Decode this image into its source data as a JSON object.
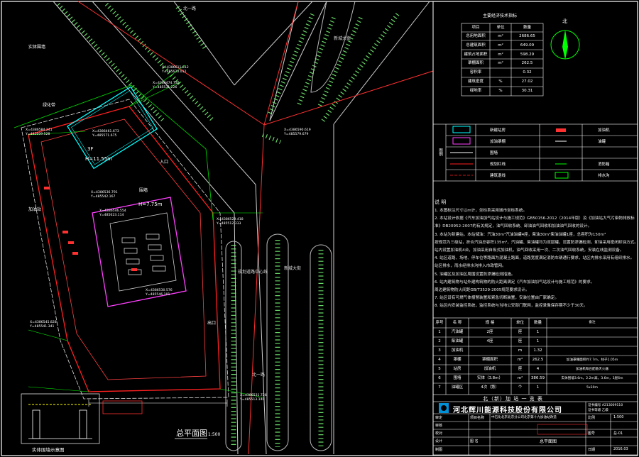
{
  "drawing": {
    "plan_title": "总平面图",
    "plan_scale": "1:500",
    "section_caption": "实体围墙示意图",
    "north_label": "北",
    "compass_header": "主要经济技术指标"
  },
  "site_labels": {
    "roads": [
      "北一路",
      "新城大街",
      "新城大街",
      "北一路"
    ],
    "building_3f": "3F",
    "building_height": "H=11.55m",
    "canopy_height": "H=7.75m",
    "entry": "入口",
    "exit": "出口",
    "weighbridge": "围墙",
    "greenbelt": "绿化带",
    "fence": "实体围墙",
    "station_name": "加油站",
    "planning_line": "规划道路中心线"
  },
  "coordinates": [
    "X=4386611.812",
    "Y=485620.012",
    "X=4386474.735",
    "Y=485531.226",
    "X=4386584.241",
    "Y=485609.528",
    "X=4386461.673",
    "Y=485571.675",
    "X=4386590.619",
    "Y=485579.679",
    "X=4386545.828",
    "Y=485541.341",
    "X=4386536.791",
    "Y=485542.167",
    "X=4386546.554",
    "Y=485623.114",
    "X=4386529.418",
    "Y=485512.333",
    "X=4386530.576",
    "Y=485546.101",
    "X=4386531.726",
    "Y=485513.140"
  ],
  "indicator_table": {
    "headers": [
      "项目",
      "单位",
      "数量"
    ],
    "rows": [
      [
        "总用地面积",
        "m²",
        "2686.65"
      ],
      [
        "总建筑面积",
        "m²",
        "649.09"
      ],
      [
        "建筑占地面积",
        "m²",
        "598.29"
      ],
      [
        "罩棚面积",
        "m²",
        "262.5"
      ],
      [
        "容积率",
        "",
        "0.32"
      ],
      [
        "建筑密度",
        "%",
        "27.02"
      ],
      [
        "绿地率",
        "%",
        "30.31"
      ]
    ]
  },
  "legend": {
    "items_left": [
      "新建站房",
      "加油罩棚",
      "围墙",
      "规划红线",
      "建筑退线"
    ],
    "items_right": [
      "加油机",
      "油罐",
      "消防箱",
      "排水沟"
    ],
    "side_label": "图例"
  },
  "notes": {
    "heading": "说 明",
    "lines": [
      "1. 本图标注尺寸以m计，坐标系采用城市坐标系统。",
      "2. 本站设计依据《汽车加油加气站设计与施工规范》GB50156-2012（2014年版）及《加油站大气污染物排放标",
      "   准》DB20952-2007的有关规定，油气回收系统、卸油油气回收和加油油气回收的设计。",
      "3. 本站为新建站，本站储油：汽油30m³汽油油罐4座，柴油30m³柴油油罐1座，总容积为150m³",
      "   按规范为三级站，折合汽油总容积135m³，汽油罐、柴油罐均为双层罐，设置防渗漏检测，卸油采用密闭卸油方式。",
      "   站内设置加油机4台，加油采用自吸式加油机，油气回收采用一次、二次油气回收系统，安装在线监测设备。",
      "4. 站区道路、场地、停车位等路面为混凝土路面，道路宽度满足消防车辆通行要求，站区内排水采用有组织排水。",
      "   站区排水，雨水经排水沟排入市政管网。",
      "5. 油罐区及加油区周围设置防渗漏检测措施。",
      "6. 站内建筑物与站外建构筑物的防火距离满足《汽车加油加气站设计与施工规范》的要求。",
      "   周边建筑物防火间距GB/T3529-2005规范要求设计。",
      "7. 站区设有可燃气体报警装置和紧急切断装置，安装位置由厂家确定。",
      "8. 站区内安装监控系统，监控系统与当地公安部门联网，监控录像保存期不少于30天。"
    ]
  },
  "equipment_table": {
    "headers": [
      "序号",
      "名 称",
      "规 格",
      "单位",
      "数量",
      "备注"
    ],
    "rows": [
      [
        "1",
        "汽油罐",
        "2座",
        "座",
        "1",
        ""
      ],
      [
        "2",
        "柴油罐",
        "4座",
        "座",
        "1",
        ""
      ],
      [
        "3",
        "加油机",
        "",
        "m",
        "1.32",
        ""
      ],
      [
        "4",
        "罩棚",
        "罩棚面积",
        "m²",
        "262.5",
        "加油罩棚面积约7.7m，柱子1.05m"
      ],
      [
        "5",
        "站房",
        "加油机",
        "座",
        "4",
        "加油机每台配备灭火器"
      ],
      [
        "6",
        "围墙",
        "实体（3.8m）",
        "m²",
        "386.59",
        "实体围墙3.6m，2.2m高，3.6m，3层6m"
      ],
      [
        "7",
        "油罐区",
        "4次（第）",
        "个",
        "1",
        "5x30m"
      ]
    ],
    "caption": "北（新）加 站 一 览 表"
  },
  "title_block": {
    "company": "河北辉川能源科技股份有限公司",
    "cert_no": "证书编号 A213009110",
    "grade": "证书等级 乙级",
    "project_label": "项目名称",
    "project": "中石化北京北京分公司北京第十九加油站改造",
    "drawing_label": "图 名",
    "drawing": "总平面图",
    "scale_label": "比例",
    "scale": "1:500",
    "sheet_label": "图号",
    "sheet": "总-01",
    "date_label": "日期",
    "date": "2016.03",
    "roles": [
      "审定",
      "审核",
      "校对",
      "设计",
      "制图"
    ]
  }
}
